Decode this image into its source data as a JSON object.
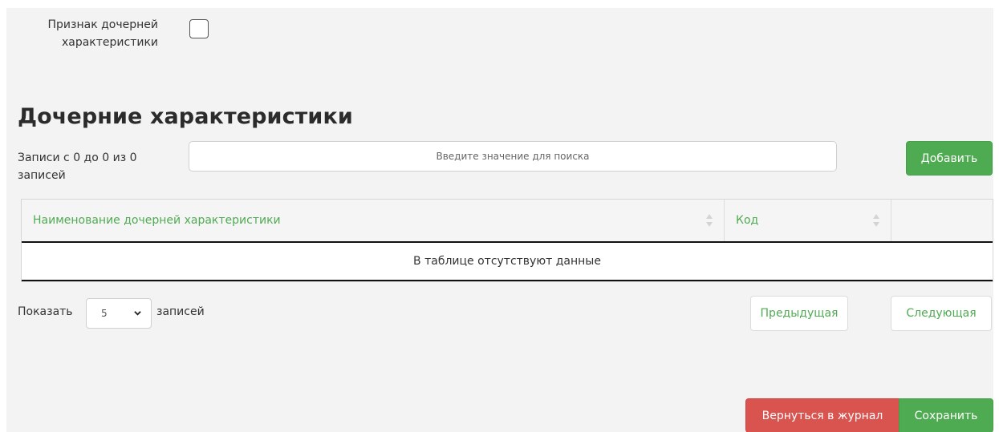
{
  "form": {
    "child_flag_label": "Признак дочерней характеристики",
    "child_flag_checked": false
  },
  "section": {
    "title": "Дочерние характеристики",
    "records_info": "Записи с 0 до 0 из 0 записей",
    "search_placeholder": "Введите значение для поиска",
    "add_label": "Добавить"
  },
  "table": {
    "columns": [
      "Наименование дочерней характеристики",
      "Код",
      ""
    ],
    "empty_text": "В таблице отсутствуют данные"
  },
  "pagination": {
    "show_label": "Показать",
    "page_size": "5",
    "entries_label": "записей",
    "prev_label": "Предыдущая",
    "next_label": "Следующая"
  },
  "footer": {
    "back_label": "Вернуться в журнал",
    "save_label": "Сохранить"
  },
  "colors": {
    "accent_green": "#4fab52",
    "danger_red": "#d9534f"
  }
}
